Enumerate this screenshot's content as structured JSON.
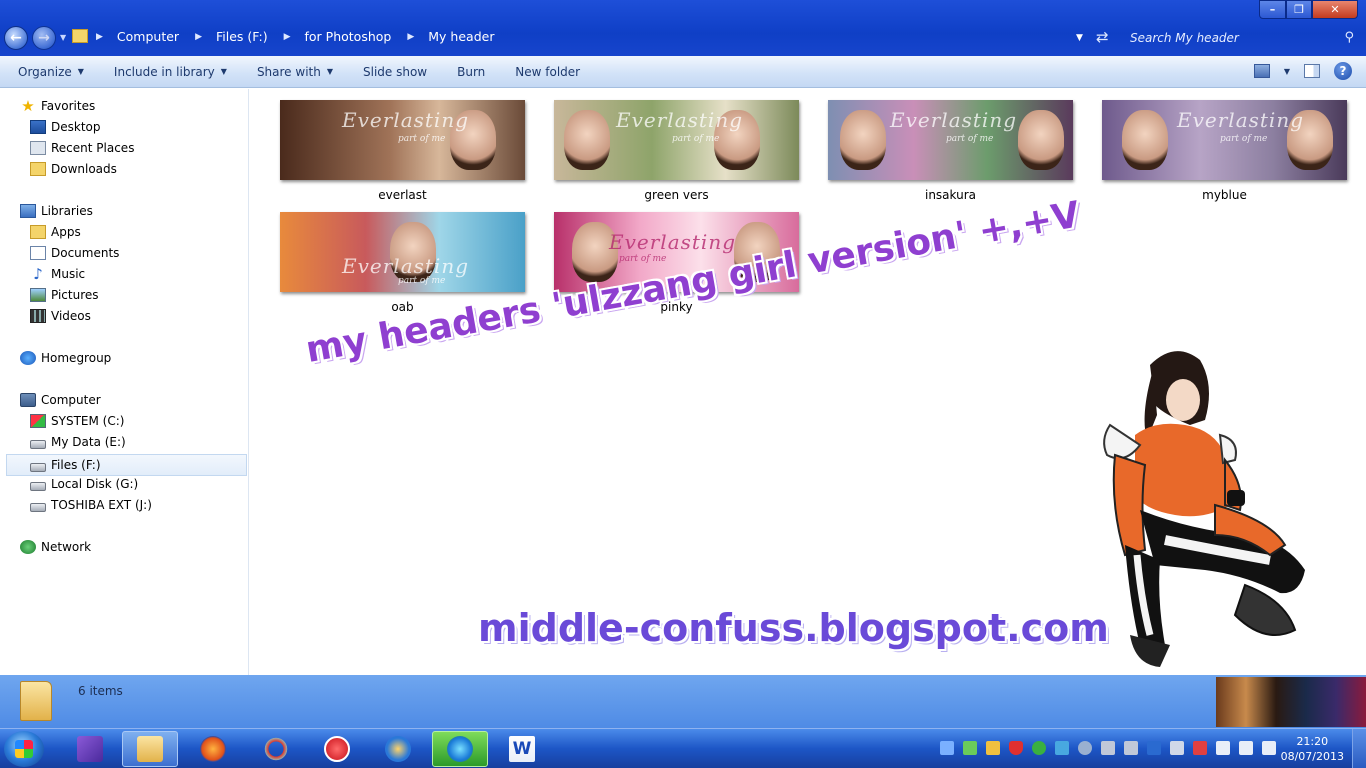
{
  "window": {
    "breadcrumbs": [
      "Computer",
      "Files (F:)",
      "for Photoshop",
      "My header"
    ],
    "search_placeholder": "Search My header"
  },
  "toolbar": {
    "organize": "Organize",
    "include_in_library": "Include in library",
    "share_with": "Share with",
    "slide_show": "Slide show",
    "burn": "Burn",
    "new_folder": "New folder"
  },
  "navpane": {
    "favorites": "Favorites",
    "desktop": "Desktop",
    "recent_places": "Recent Places",
    "downloads": "Downloads",
    "libraries": "Libraries",
    "apps": "Apps",
    "documents": "Documents",
    "music": "Music",
    "pictures": "Pictures",
    "videos": "Videos",
    "homegroup": "Homegroup",
    "computer": "Computer",
    "system_c": "SYSTEM (C:)",
    "mydata_e": "My Data (E:)",
    "files_f": "Files (F:)",
    "localdisk_g": "Local Disk (G:)",
    "toshiba_j": "TOSHIBA EXT (J:)",
    "network": "Network"
  },
  "files": [
    {
      "name": "everlast",
      "watermark": "Everlasting",
      "sub": "part of me"
    },
    {
      "name": "green vers",
      "watermark": "Everlasting",
      "sub": "part of me"
    },
    {
      "name": "insakura",
      "watermark": "Everlasting",
      "sub": "part of me"
    },
    {
      "name": "myblue",
      "watermark": "Everlasting",
      "sub": "part of me"
    },
    {
      "name": "oab",
      "watermark": "Everlasting",
      "sub": "part of me"
    },
    {
      "name": "pinky",
      "watermark": "Everlasting",
      "sub": "part of me"
    }
  ],
  "overlay": {
    "headline": "my headers 'ulzzang girl version' +,+V",
    "blog": "middle-confuss.blogspot.com"
  },
  "details": {
    "item_count": "6 items"
  },
  "taskbar": {
    "time": "21:20",
    "date": "08/07/2013",
    "word_glyph": "W"
  },
  "colors": {
    "titlebar": "#1745cc",
    "details_pane": "#4f8be5",
    "overlay_purple": "#8f3fd0"
  }
}
